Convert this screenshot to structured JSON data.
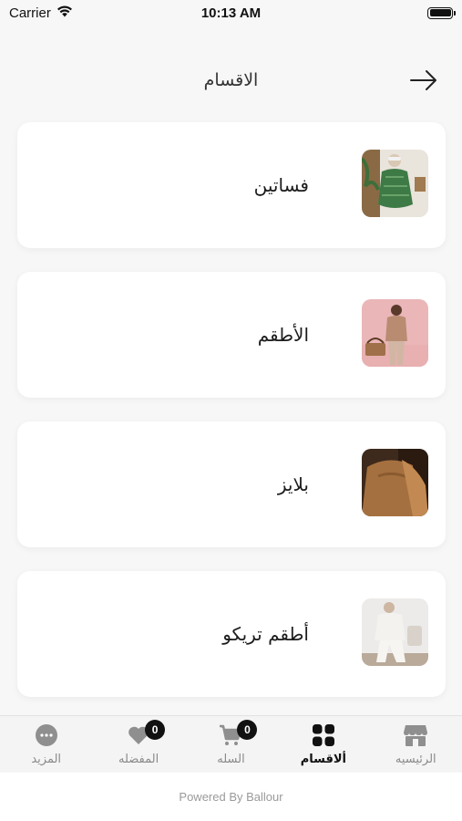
{
  "status_bar": {
    "carrier": "Carrier",
    "time": "10:13 AM"
  },
  "header": {
    "title": "الاقسام",
    "back_icon": "arrow-right-icon"
  },
  "categories": [
    {
      "label": "فساتين",
      "thumb": "dress-photo"
    },
    {
      "label": "الأطقم",
      "thumb": "outfit-photo"
    },
    {
      "label": "بلايز",
      "thumb": "blouse-photo"
    },
    {
      "label": "أطقم تريكو",
      "thumb": "knit-set-photo"
    }
  ],
  "tabbar": {
    "tabs": [
      {
        "label": "المزيد",
        "icon": "more-icon",
        "active": false
      },
      {
        "label": "المفضله",
        "icon": "heart-icon",
        "active": false,
        "badge": "0"
      },
      {
        "label": "السله",
        "icon": "cart-icon",
        "active": false,
        "badge": "0"
      },
      {
        "label": "ألاقسام",
        "icon": "grid-icon",
        "active": true
      },
      {
        "label": "الرئيسيه",
        "icon": "store-icon",
        "active": false
      }
    ]
  },
  "footer": {
    "text": "Powered By Ballour"
  },
  "colors": {
    "background": "#f7f7f7",
    "card": "#ffffff",
    "active_tab": "#111111",
    "inactive_tab": "#8a8a8a"
  }
}
